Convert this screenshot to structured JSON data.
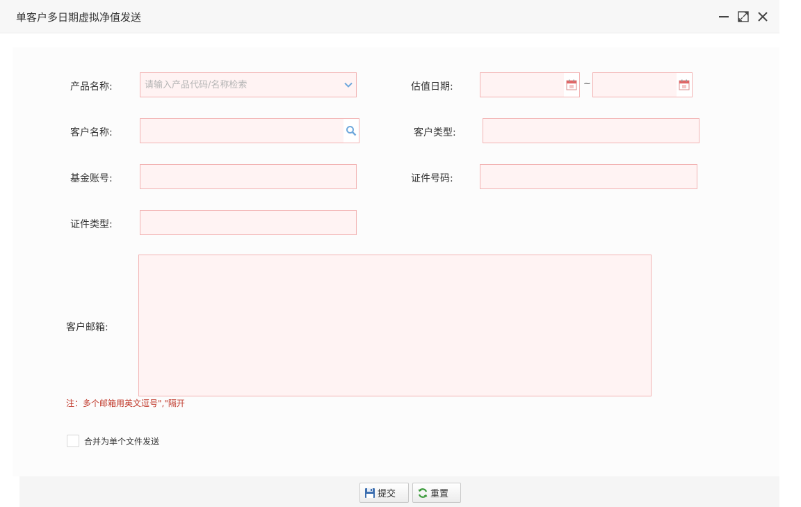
{
  "window": {
    "title": "单客户多日期虚拟净值发送"
  },
  "form": {
    "product_name": {
      "label": "产品名称:",
      "placeholder": "请输入产品代码/名称检索"
    },
    "valuation_date": {
      "label": "估值日期:",
      "separator": "~"
    },
    "customer_name": {
      "label": "客户名称:"
    },
    "customer_type": {
      "label": "客户类型:"
    },
    "fund_account": {
      "label": "基金账号:"
    },
    "id_number": {
      "label": "证件号码:"
    },
    "id_type": {
      "label": "证件类型:"
    },
    "customer_email": {
      "label": "客户邮箱:",
      "note": "注：多个邮箱用英文逗号\",\"隔开"
    },
    "merge_checkbox": {
      "label": "合并为单个文件发送",
      "checked": false
    }
  },
  "footer": {
    "submit_label": "提交",
    "reset_label": "重置"
  },
  "colors": {
    "field_bg": "#fff3f3",
    "field_border": "#f2b2b2",
    "note_text": "#c0392b",
    "icon_blue": "#6fa8dc"
  }
}
